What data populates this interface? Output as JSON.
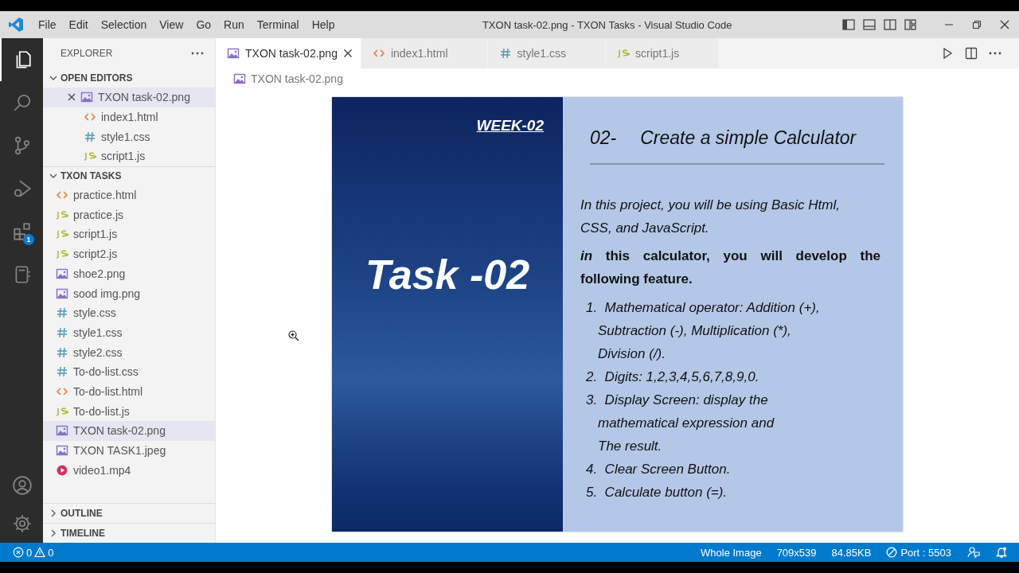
{
  "window": {
    "title": "TXON task-02.png - TXON Tasks - Visual Studio Code"
  },
  "menu": [
    "File",
    "Edit",
    "Selection",
    "View",
    "Go",
    "Run",
    "Terminal",
    "Help"
  ],
  "activity_bar": [
    {
      "kind": "explorer",
      "selected": true
    },
    {
      "kind": "search",
      "selected": false
    },
    {
      "kind": "source-control",
      "selected": false
    },
    {
      "kind": "run-debug",
      "selected": false
    },
    {
      "kind": "extensions",
      "selected": false,
      "badge": "1"
    },
    {
      "kind": "notebook",
      "selected": false
    }
  ],
  "activity_bar_bottom": [
    {
      "kind": "account"
    },
    {
      "kind": "settings"
    }
  ],
  "sidebar": {
    "title": "EXPLORER",
    "sections": [
      {
        "title": "OPEN EDITORS",
        "expanded": true,
        "items": [
          {
            "name": "TXON task-02.png",
            "kind": "image",
            "selected": true
          },
          {
            "name": "index1.html",
            "kind": "html",
            "selected": false
          },
          {
            "name": "style1.css",
            "kind": "css",
            "selected": false
          },
          {
            "name": "script1.js",
            "kind": "js",
            "selected": false
          }
        ]
      },
      {
        "title": "TXON TASKS",
        "expanded": true,
        "items": [
          {
            "name": "practice.html",
            "kind": "html",
            "selected": false
          },
          {
            "name": "practice.js",
            "kind": "js",
            "selected": false
          },
          {
            "name": "script1.js",
            "kind": "js",
            "selected": false
          },
          {
            "name": "script2.js",
            "kind": "js",
            "selected": false
          },
          {
            "name": "shoe2.png",
            "kind": "image",
            "selected": false
          },
          {
            "name": "sood img.png",
            "kind": "image",
            "selected": false
          },
          {
            "name": "style.css",
            "kind": "css",
            "selected": false
          },
          {
            "name": "style1.css",
            "kind": "css",
            "selected": false
          },
          {
            "name": "style2.css",
            "kind": "css",
            "selected": false
          },
          {
            "name": "To-do-list.css",
            "kind": "css",
            "selected": false
          },
          {
            "name": "To-do-list.html",
            "kind": "html",
            "selected": false
          },
          {
            "name": "To-do-list.js",
            "kind": "js",
            "selected": false
          },
          {
            "name": "TXON task-02.png",
            "kind": "image",
            "selected": true
          },
          {
            "name": "TXON TASK1.jpeg",
            "kind": "image",
            "selected": false
          },
          {
            "name": "video1.mp4",
            "kind": "video",
            "selected": false
          }
        ]
      },
      {
        "title": "OUTLINE",
        "expanded": false
      },
      {
        "title": "TIMELINE",
        "expanded": false
      }
    ]
  },
  "tabs": [
    {
      "label": "TXON task-02.png",
      "kind": "image",
      "selected": true
    },
    {
      "label": "index1.html",
      "kind": "html",
      "selected": false
    },
    {
      "label": "style1.css",
      "kind": "css",
      "selected": false
    },
    {
      "label": "script1.js",
      "kind": "js",
      "selected": false
    }
  ],
  "breadcrumb": {
    "label": "TXON task-02.png",
    "kind": "image"
  },
  "image_document": {
    "week": "WEEK-02",
    "title": "Task -02",
    "heading_number": "02-",
    "heading": "Create a simple Calculator",
    "paragraphs": [
      {
        "kind": "italic",
        "lines": [
          "In this project, you will be using Basic Html,",
          "CSS, and JavaScript."
        ]
      },
      {
        "kind": "bold",
        "lines": [
          "*in* this calculator, you will develop the",
          "following feature."
        ]
      }
    ],
    "list": [
      {
        "number": "1.",
        "lines": [
          "Mathematical operator: Addition (+),",
          "Subtraction (-), Multiplication (*),",
          "Division (/)."
        ]
      },
      {
        "number": "2.",
        "lines": [
          "Digits: 1,2,3,4,5,6,7,8,9,0."
        ]
      },
      {
        "number": "3.",
        "lines": [
          "Display Screen: display the",
          "mathematical expression and",
          "The result."
        ]
      },
      {
        "number": "4.",
        "lines": [
          "Clear Screen Button."
        ]
      },
      {
        "number": "5.",
        "lines": [
          "Calculate button (=)."
        ]
      }
    ]
  },
  "status_bar": {
    "errors": "0",
    "warnings": "0",
    "items": [
      {
        "kind": "text",
        "label": "Whole Image"
      },
      {
        "kind": "text",
        "label": "709x539"
      },
      {
        "kind": "text",
        "label": "84.85KB"
      },
      {
        "kind": "port",
        "label": "Port : 5503"
      },
      {
        "kind": "feedback"
      },
      {
        "kind": "bell"
      }
    ]
  }
}
